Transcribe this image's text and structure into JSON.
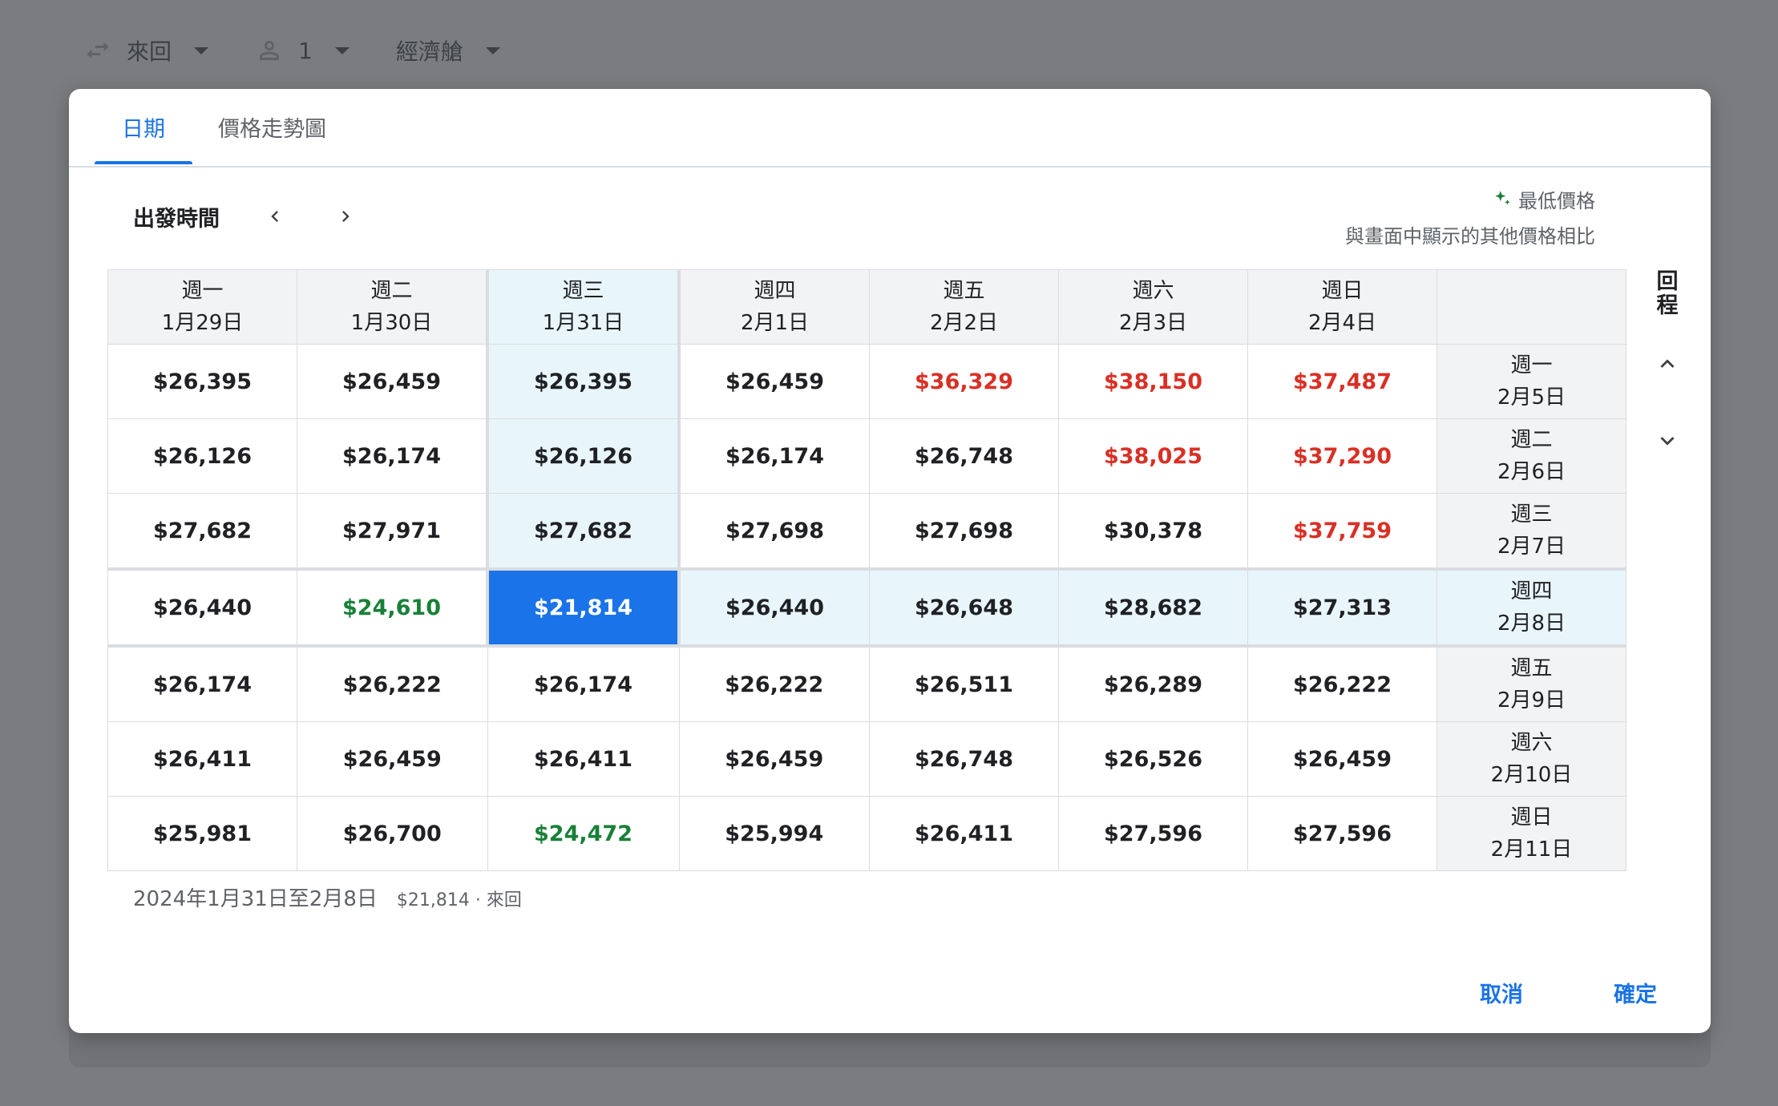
{
  "topbar": {
    "trip_type": "來回",
    "passengers": "1",
    "cabin": "經濟艙"
  },
  "tabs": [
    {
      "label": "日期",
      "active": true
    },
    {
      "label": "價格走勢圖",
      "active": false
    }
  ],
  "departure": {
    "label": "出發時間"
  },
  "legend": {
    "title": "最低價格",
    "subtitle": "與畫面中顯示的其他價格相比"
  },
  "return_label": "回程",
  "columns": [
    {
      "weekday": "週一",
      "date": "1月29日"
    },
    {
      "weekday": "週二",
      "date": "1月30日"
    },
    {
      "weekday": "週三",
      "date": "1月31日"
    },
    {
      "weekday": "週四",
      "date": "2月1日"
    },
    {
      "weekday": "週五",
      "date": "2月2日"
    },
    {
      "weekday": "週六",
      "date": "2月3日"
    },
    {
      "weekday": "週日",
      "date": "2月4日"
    }
  ],
  "rows": [
    {
      "weekday": "週一",
      "date": "2月5日",
      "prices": [
        "$26,395",
        "$26,459",
        "$26,395",
        "$26,459",
        "$36,329",
        "$38,150",
        "$37,487"
      ],
      "status": [
        "",
        "",
        "",
        "",
        "high",
        "high",
        "high"
      ]
    },
    {
      "weekday": "週二",
      "date": "2月6日",
      "prices": [
        "$26,126",
        "$26,174",
        "$26,126",
        "$26,174",
        "$26,748",
        "$38,025",
        "$37,290"
      ],
      "status": [
        "",
        "",
        "",
        "",
        "",
        "high",
        "high"
      ]
    },
    {
      "weekday": "週三",
      "date": "2月7日",
      "prices": [
        "$27,682",
        "$27,971",
        "$27,682",
        "$27,698",
        "$27,698",
        "$30,378",
        "$37,759"
      ],
      "status": [
        "",
        "",
        "",
        "",
        "",
        "",
        "high"
      ]
    },
    {
      "weekday": "週四",
      "date": "2月8日",
      "prices": [
        "$26,440",
        "$24,610",
        "$21,814",
        "$26,440",
        "$26,648",
        "$28,682",
        "$27,313"
      ],
      "status": [
        "",
        "low",
        "selected",
        "",
        "",
        "",
        ""
      ]
    },
    {
      "weekday": "週五",
      "date": "2月9日",
      "prices": [
        "$26,174",
        "$26,222",
        "$26,174",
        "$26,222",
        "$26,511",
        "$26,289",
        "$26,222"
      ],
      "status": [
        "",
        "",
        "",
        "",
        "",
        "",
        ""
      ]
    },
    {
      "weekday": "週六",
      "date": "2月10日",
      "prices": [
        "$26,411",
        "$26,459",
        "$26,411",
        "$26,459",
        "$26,748",
        "$26,526",
        "$26,459"
      ],
      "status": [
        "",
        "",
        "",
        "",
        "",
        "",
        ""
      ]
    },
    {
      "weekday": "週日",
      "date": "2月11日",
      "prices": [
        "$25,981",
        "$26,700",
        "$24,472",
        "$25,994",
        "$26,411",
        "$27,596",
        "$27,596"
      ],
      "status": [
        "",
        "",
        "low",
        "",
        "",
        "",
        ""
      ]
    }
  ],
  "selected": {
    "departure_col": 2,
    "return_row": 3
  },
  "summary": {
    "dates": "2024年1月31日至2月8日",
    "price": "$21,814 · 來回"
  },
  "buttons": {
    "cancel": "取消",
    "confirm": "確定"
  },
  "colors": {
    "accent": "#1a73e8",
    "high": "#d93025",
    "low": "#188038",
    "highlight": "#e8f6fb"
  }
}
